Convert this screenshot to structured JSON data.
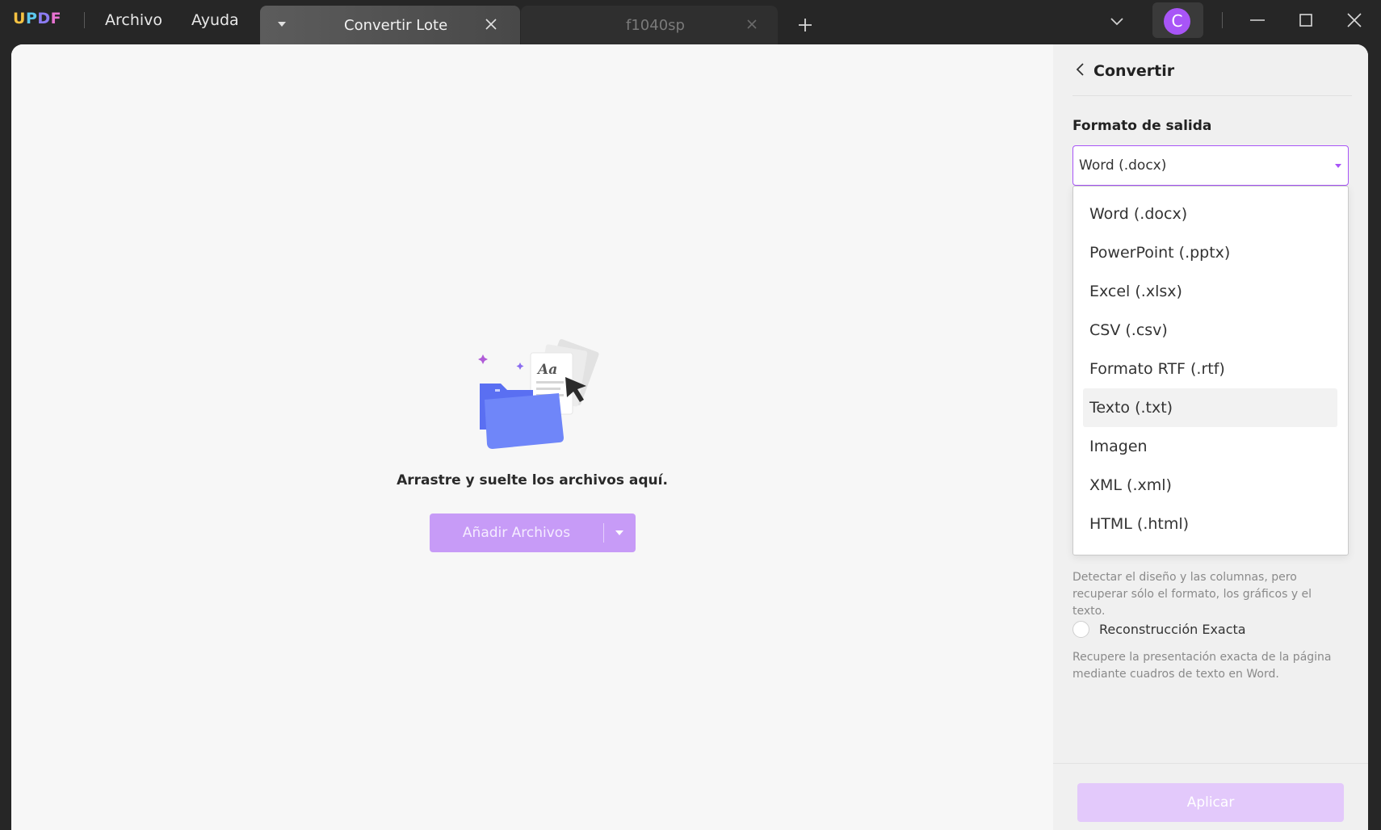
{
  "app": {
    "logo": {
      "u": "U",
      "p": "P",
      "d": "D",
      "f": "F"
    },
    "menu": {
      "archivo": "Archivo",
      "ayuda": "Ayuda"
    },
    "avatar_letter": "C"
  },
  "tabs": [
    {
      "label": "Convertir Lote",
      "active": true
    },
    {
      "label": "f1040sp",
      "active": false
    }
  ],
  "main": {
    "drop_text": "Arrastre y suelte los archivos aquí.",
    "add_button_label": "Añadir Archivos",
    "illustration_text": "Aa"
  },
  "panel": {
    "title": "Convertir",
    "output_format_label": "Formato de salida",
    "selected_format": "Word (.docx)",
    "format_options": [
      "Word (.docx)",
      "PowerPoint (.pptx)",
      "Excel (.xlsx)",
      "CSV (.csv)",
      "Formato RTF (.rtf)",
      "Texto (.txt)",
      "Imagen",
      "XML (.xml)",
      "HTML (.html)"
    ],
    "hovered_option_index": 5,
    "option1_desc": "Detectar el diseño y las columnas, pero recuperar sólo el formato, los gráficos y el texto.",
    "option2_label": "Reconstrucción Exacta",
    "option2_desc": "Recupere la presentación exacta de la página mediante cuadros de texto en Word.",
    "apply_label": "Aplicar"
  },
  "colors": {
    "accent": "#a855f7",
    "add_button": "#c79bf7",
    "apply_button": "#e3c9fb",
    "titlebar": "#262626"
  },
  "icons": {
    "tab_dropdown": "caret-down-icon",
    "tab_close": "close-icon",
    "new_tab": "plus-icon",
    "tabs_overflow": "chevron-down-icon",
    "back": "chevron-left-icon",
    "minimize": "minimize-icon",
    "maximize": "maximize-icon",
    "window_close": "close-icon"
  }
}
